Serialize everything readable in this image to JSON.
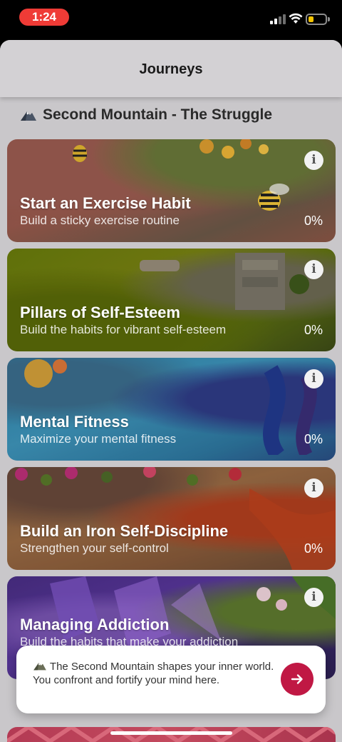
{
  "status_bar": {
    "time": "1:24",
    "time_pill_color": "#ef3b36",
    "icons": [
      "cellular-signal-icon",
      "wifi-icon",
      "battery-icon"
    ],
    "battery_level": 0.25,
    "battery_color": "#f5c400"
  },
  "header": {
    "title": "Journeys"
  },
  "section": {
    "icon": "mountain-icon",
    "title": "Second Mountain - The Struggle"
  },
  "journeys": [
    {
      "title": "Start an Exercise Habit",
      "subtitle": "Build a sticky exercise routine",
      "progress": "0%"
    },
    {
      "title": "Pillars of Self-Esteem",
      "subtitle": "Build the habits for vibrant self-esteem",
      "progress": "0%"
    },
    {
      "title": "Mental Fitness",
      "subtitle": "Maximize your mental fitness",
      "progress": "0%"
    },
    {
      "title": "Build an Iron Self-Discipline",
      "subtitle": "Strengthen your self-control",
      "progress": "0%"
    },
    {
      "title": "Managing Addiction",
      "subtitle": "Build the habits that make your addiction"
    }
  ],
  "toast": {
    "icon": "mountain-icon",
    "text": "The Second Mountain shapes your inner world. You confront and fortify your mind here.",
    "button_icon": "arrow-right-icon",
    "button_color": "#c01844"
  }
}
